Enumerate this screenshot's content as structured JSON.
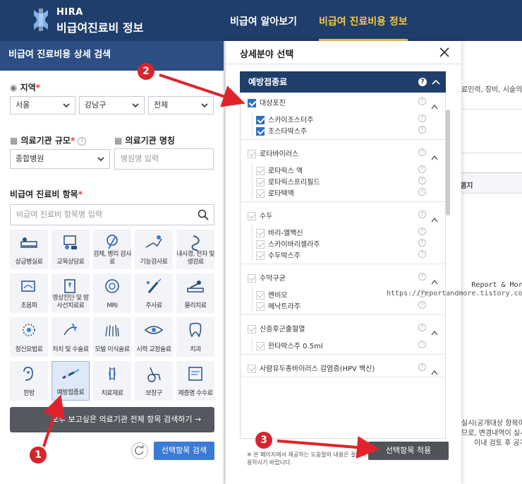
{
  "header": {
    "logo_line1": "HIRA",
    "logo_line2": "비급여진료비 정보",
    "nav": [
      "비급여 알아보기",
      "비급여 진료비용 정보"
    ]
  },
  "left_panel": {
    "title": "비급여 진료비용 상세 검색",
    "region_label": "지역",
    "region": {
      "sido": "서울",
      "sigungu": "강남구",
      "dong": "전체"
    },
    "scale_label": "의료기관 규모",
    "scale_value": "종합병원",
    "name_label": "의료기관 명칭",
    "name_placeholder": "병원명 입력",
    "items_label": "비급여 진료비 항목",
    "items_placeholder": "비급여 진료비 항목명 입력",
    "tiles": [
      "상급병실료",
      "교육상담료",
      "검체, 병리 검사료",
      "기능검사료",
      "내시경, 천자 및 생검료",
      "초음파",
      "영상진단 및 방사선치료료",
      "MRI",
      "주사료",
      "물리치료",
      "정신요법료",
      "처치 및 수술료",
      "모발 이식술료",
      "시력 교정술료",
      "치과",
      "한방",
      "예방접종료",
      "치료재료",
      "보장구",
      "제증명 수수료"
    ],
    "all_search_button": "모두 보고싶은 의료기관 전체 항목 검색하기",
    "selected_search_button": "선택항목 검색"
  },
  "background": {
    "line1": "료인력, 장비, 시술의",
    "col_header": "램지",
    "bottom1": "실시(공개대상 항목이",
    "bottom2": "므로, 변경내역이 실시",
    "bottom3": "이내 검토 후 공개"
  },
  "modal": {
    "title": "상세분야 선택",
    "category": "예방접종료",
    "groups": [
      {
        "name": "대상포진",
        "checked": true,
        "items": [
          {
            "name": "스카이조스터주",
            "checked": true
          },
          {
            "name": "조스타박스주",
            "checked": true
          }
        ]
      },
      {
        "name": "로타바이러스",
        "checked": false,
        "items": [
          {
            "name": "로타릭스 액",
            "checked": false
          },
          {
            "name": "로타릭스프리필드",
            "checked": false
          },
          {
            "name": "로타텍액",
            "checked": false
          }
        ]
      },
      {
        "name": "수두",
        "checked": false,
        "items": [
          {
            "name": "바리-엘백신",
            "checked": false
          },
          {
            "name": "스카이바리셀라주",
            "checked": false
          },
          {
            "name": "수두박스주",
            "checked": false
          }
        ]
      },
      {
        "name": "수막구균",
        "checked": false,
        "items": [
          {
            "name": "멘비오",
            "checked": false
          },
          {
            "name": "메낙트라주",
            "checked": false
          }
        ]
      },
      {
        "name": "신증후군출혈열",
        "checked": false,
        "items": [
          {
            "name": "한타박스주 0.5ml",
            "checked": false
          }
        ]
      },
      {
        "name": "사람유두종바이러스 감염증(HPV 백신)",
        "checked": false,
        "items": []
      }
    ],
    "note": "※ 본 페이지에서 제공하는 도움말의 내용은 절대적 기준이 아니므로 참고자료로 활용하시기 바랍니다.",
    "apply_button": "선택항목 적용"
  },
  "annotations": {
    "badges": [
      "1",
      "2",
      "3"
    ],
    "watermark_line1": "Report & More",
    "watermark_line2": "https://reportandmore.tistory.com"
  },
  "colors": {
    "header": "#1f3e6b",
    "accent": "#f3c64a",
    "primary": "#3a7bd5",
    "checked": "#2f6fc8",
    "annotation": "#d8242c"
  }
}
